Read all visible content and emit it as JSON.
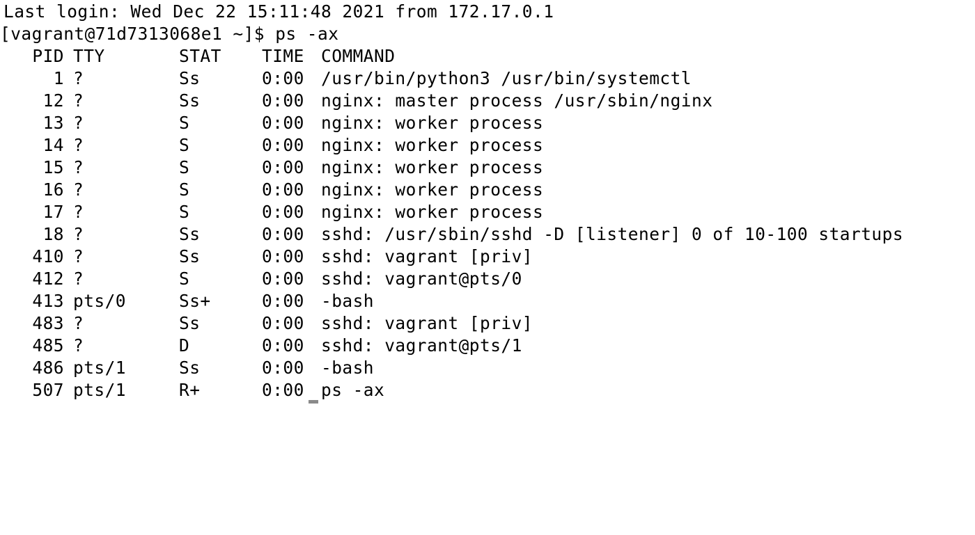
{
  "terminal": {
    "last_login": "Last login: Wed Dec 22 15:11:48 2021 from 172.17.0.1",
    "prompt": "[vagrant@71d7313068e1 ~]$ ps -ax",
    "headers": {
      "pid": "PID",
      "tty": "TTY",
      "stat": "STAT",
      "time": "TIME",
      "command": "COMMAND"
    },
    "processes": [
      {
        "pid": "1",
        "tty": "?",
        "stat": "Ss",
        "time": "0:00",
        "command": "/usr/bin/python3 /usr/bin/systemctl"
      },
      {
        "pid": "12",
        "tty": "?",
        "stat": "Ss",
        "time": "0:00",
        "command": "nginx: master process /usr/sbin/nginx"
      },
      {
        "pid": "13",
        "tty": "?",
        "stat": "S",
        "time": "0:00",
        "command": "nginx: worker process"
      },
      {
        "pid": "14",
        "tty": "?",
        "stat": "S",
        "time": "0:00",
        "command": "nginx: worker process"
      },
      {
        "pid": "15",
        "tty": "?",
        "stat": "S",
        "time": "0:00",
        "command": "nginx: worker process"
      },
      {
        "pid": "16",
        "tty": "?",
        "stat": "S",
        "time": "0:00",
        "command": "nginx: worker process"
      },
      {
        "pid": "17",
        "tty": "?",
        "stat": "S",
        "time": "0:00",
        "command": "nginx: worker process"
      },
      {
        "pid": "18",
        "tty": "?",
        "stat": "Ss",
        "time": "0:00",
        "command": "sshd: /usr/sbin/sshd -D [listener] 0 of 10-100 startups"
      },
      {
        "pid": "410",
        "tty": "?",
        "stat": "Ss",
        "time": "0:00",
        "command": "sshd: vagrant [priv]"
      },
      {
        "pid": "412",
        "tty": "?",
        "stat": "S",
        "time": "0:00",
        "command": "sshd: vagrant@pts/0"
      },
      {
        "pid": "413",
        "tty": "pts/0",
        "stat": "Ss+",
        "time": "0:00",
        "command": "-bash"
      },
      {
        "pid": "483",
        "tty": "?",
        "stat": "Ss",
        "time": "0:00",
        "command": "sshd: vagrant [priv]"
      },
      {
        "pid": "485",
        "tty": "?",
        "stat": "D",
        "time": "0:00",
        "command": "sshd: vagrant@pts/1"
      },
      {
        "pid": "486",
        "tty": "pts/1",
        "stat": "Ss",
        "time": "0:00",
        "command": "-bash"
      },
      {
        "pid": "507",
        "tty": "pts/1",
        "stat": "R+",
        "time": "0:00",
        "command": "ps -ax"
      }
    ]
  }
}
